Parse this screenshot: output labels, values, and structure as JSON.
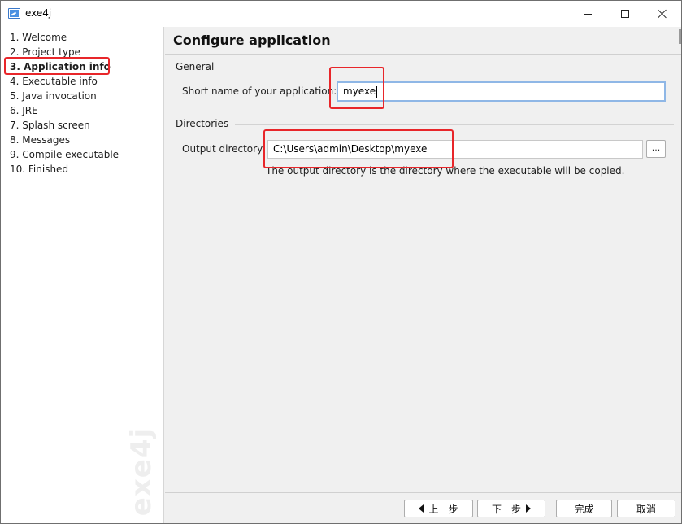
{
  "window": {
    "title": "exe4j",
    "icon": "exe4j-app-icon",
    "controls": [
      "minimize-icon",
      "maximize-icon",
      "close-icon"
    ]
  },
  "sidebar": {
    "steps": [
      {
        "label": "1. Welcome",
        "active": false
      },
      {
        "label": "2. Project type",
        "active": false
      },
      {
        "label": "3. Application info",
        "active": true
      },
      {
        "label": "4. Executable info",
        "active": false
      },
      {
        "label": "5. Java invocation",
        "active": false
      },
      {
        "label": "6. JRE",
        "active": false
      },
      {
        "label": "7. Splash screen",
        "active": false
      },
      {
        "label": "8. Messages",
        "active": false
      },
      {
        "label": "9. Compile executable",
        "active": false
      },
      {
        "label": "10. Finished",
        "active": false
      }
    ],
    "watermark": "exe4j"
  },
  "main": {
    "title": "Configure application",
    "general": {
      "label": "General",
      "short_name_label": "Short name of your application:",
      "short_name_value": "myexe"
    },
    "directories": {
      "label": "Directories",
      "output_label": "Output directory:",
      "output_value": "C:\\Users\\admin\\Desktop\\myexe",
      "browse_label": "...",
      "hint": "The output directory is the directory where the executable will be copied."
    }
  },
  "footer": {
    "prev_label": "上一步",
    "next_label": "下一步",
    "finish_label": "完成",
    "cancel_label": "取消"
  },
  "colors": {
    "highlight": "#e8262a",
    "input_focus": "#8fb7e6",
    "panel": "#f0f0f0"
  }
}
